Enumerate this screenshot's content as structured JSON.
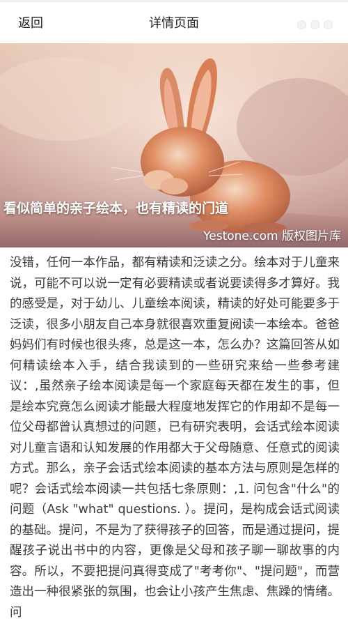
{
  "header": {
    "back_label": "返回",
    "title": "详情页面",
    "more_icon": "more-dots-icon"
  },
  "hero": {
    "caption": "看似简单的亲子绘本，也有精读的门道",
    "watermark": "Yestone.com 版权图片库"
  },
  "article": {
    "body": "没错，任何一本作品，都有精读和泛读之分。绘本对于儿童来说，可能不可以说一定有必要精读或者说要读得多才算好。我的感受是，对于幼儿、儿童绘本阅读，精读的好处可能要多于泛读，很多小朋友自己本身就很喜欢重复阅读一本绘本。爸爸妈妈们有时候也很头疼，总是这一本，怎么办？这篇回答从如何精读绘本入手，结合我读到的一些研究来给一些参考建议：,虽然亲子绘本阅读是每一个家庭每天都在发生的事，但是绘本究竟怎么阅读才能最大程度地发挥它的作用却不是每一位父母都曾认真想过的问题，已有研究表明，会话式绘本阅读对儿童言语和认知发展的作用都大于父母随意、任意式的阅读方式。那么，亲子会话式绘本阅读的基本方法与原则是怎样的呢？会话式绘本阅读一共包括七条原则：,1. 问包含\"什么\"的问题（Ask \"what\" questions. ）。提问，是构成会话式阅读的基础。提问，不是为了获得孩子的回答，而是通过提问，提醒孩子说出书中的内容，更像是父母和孩子聊一聊故事的内容。所以，不要把提问真得变成了\"考考你\"、\"提问题\"，而营造出一种很紧张的氛围，也会让小孩产生焦虑、焦躁的情绪。问"
  },
  "colors": {
    "background": "#ffffff",
    "text": "#3c3c3c",
    "title": "#222222",
    "hero_tint": "#d9b4a5"
  }
}
